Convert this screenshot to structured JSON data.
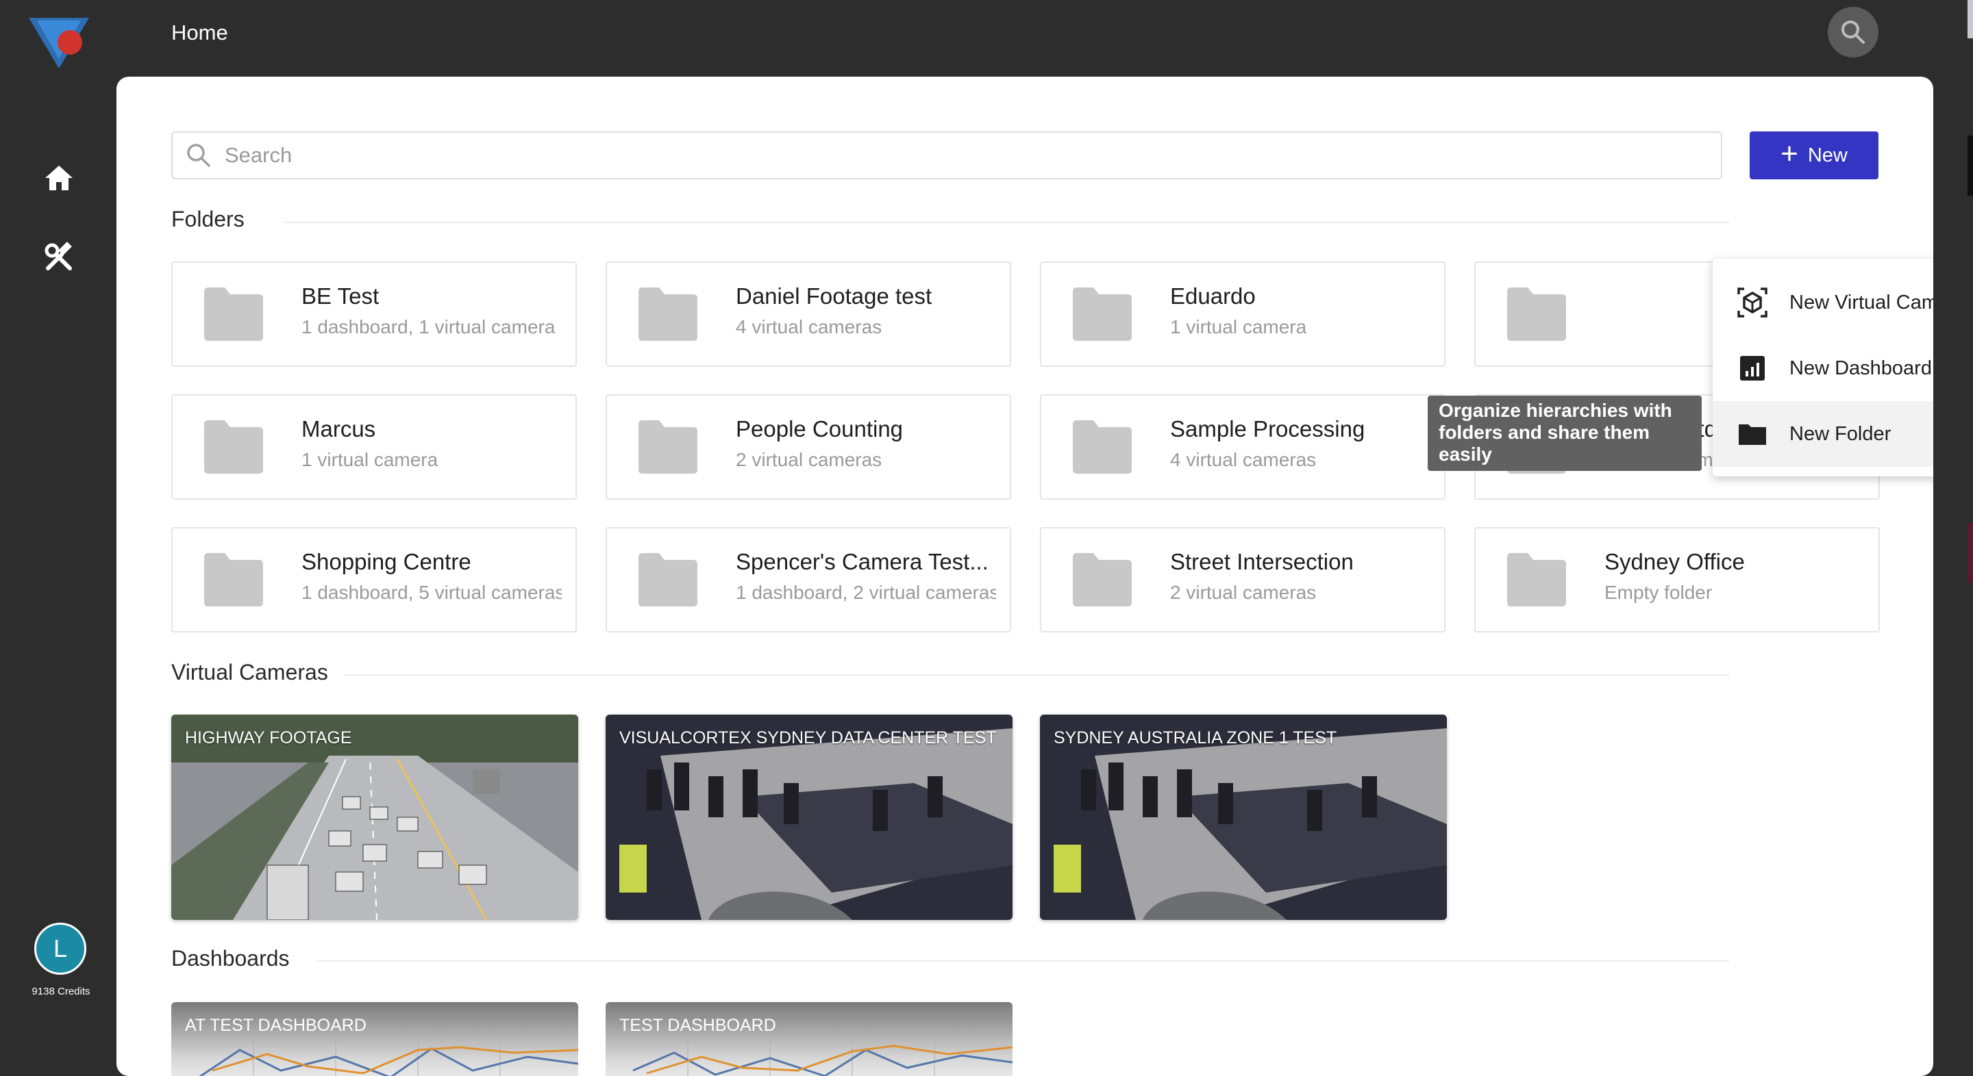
{
  "app": {
    "title": "Home",
    "credits": "9138 Credits",
    "user_initial": "L"
  },
  "colors": {
    "accent": "#3535c4",
    "background": "#2d2d2d",
    "avatar": "#1a8aa5",
    "folder_icon": "#c8c8c8"
  },
  "search": {
    "placeholder": "Search"
  },
  "new_button": {
    "label": "New"
  },
  "sections": {
    "folders": "Folders",
    "virtual_cameras": "Virtual Cameras",
    "dashboards": "Dashboards"
  },
  "folders": [
    {
      "name": "BE Test",
      "subtitle": "1 dashboard, 1 virtual camera"
    },
    {
      "name": "Daniel Footage test",
      "subtitle": "4 virtual cameras"
    },
    {
      "name": "Eduardo",
      "subtitle": "1 virtual camera"
    },
    {
      "name": "",
      "subtitle": ""
    },
    {
      "name": "Marcus",
      "subtitle": "1 virtual camera"
    },
    {
      "name": "People Counting",
      "subtitle": "2 virtual cameras"
    },
    {
      "name": "Sample Processing",
      "subtitle": "4 virtual cameras"
    },
    {
      "name": "Sam's outdoor recordi...",
      "subtitle": "1 virtual camera"
    },
    {
      "name": "Shopping Centre",
      "subtitle": "1 dashboard, 5 virtual cameras"
    },
    {
      "name": "Spencer's Camera Test...",
      "subtitle": "1 dashboard, 2 virtual cameras"
    },
    {
      "name": "Street Intersection",
      "subtitle": "2 virtual cameras"
    },
    {
      "name": "Sydney Office",
      "subtitle": "Empty folder"
    }
  ],
  "virtual_cameras": [
    {
      "label": "HIGHWAY FOOTAGE"
    },
    {
      "label": "VISUALCORTEX SYDNEY DATA CENTER TEST"
    },
    {
      "label": "SYDNEY AUSTRALIA ZONE 1 TEST"
    }
  ],
  "dashboards": [
    {
      "label": "AT TEST DASHBOARD"
    },
    {
      "label": "TEST DASHBOARD"
    }
  ],
  "menu": {
    "items": [
      {
        "label": "New Virtual Camera",
        "icon": "virtual-camera-icon"
      },
      {
        "label": "New Dashboard",
        "icon": "dashboard-icon"
      },
      {
        "label": "New Folder",
        "icon": "folder-icon"
      }
    ]
  },
  "tooltip": {
    "text": "Organize hierarchies with folders and share them easily"
  }
}
